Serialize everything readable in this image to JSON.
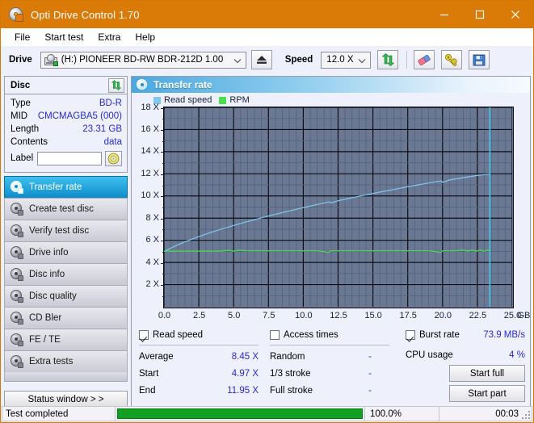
{
  "window": {
    "title": "Opti Drive Control 1.70",
    "icon": "disc-icon",
    "minimize": "minimize-icon",
    "maximize": "maximize-icon",
    "close": "close-icon",
    "accent": "#d97b06"
  },
  "menu": {
    "items": [
      "File",
      "Start test",
      "Extra",
      "Help"
    ]
  },
  "toolbar": {
    "drive_label": "Drive",
    "drive_value": "(H:)  PIONEER BD-RW   BDR-212D 1.00",
    "eject_icon": "eject-icon",
    "speed_label": "Speed",
    "speed_value": "12.0 X",
    "refresh_icon": "refresh-icon",
    "eraser_icon": "eraser-icon",
    "tools_icon": "tools-icon",
    "save_icon": "save-icon"
  },
  "disc": {
    "title": "Disc",
    "refresh_icon": "refresh-icon",
    "rows": [
      {
        "key": "Type",
        "value": "BD-R"
      },
      {
        "key": "MID",
        "value": "CMCMAGBA5 (000)"
      },
      {
        "key": "Length",
        "value": "23.31 GB"
      },
      {
        "key": "Contents",
        "value": "data"
      }
    ],
    "label_key": "Label",
    "label_value": "",
    "label_placeholder": "",
    "label_icon": "cd-icon"
  },
  "nav": {
    "items": [
      {
        "label": "Transfer rate",
        "icon": "disc-icon",
        "active": true
      },
      {
        "label": "Create test disc",
        "icon": "disc-icon",
        "active": false
      },
      {
        "label": "Verify test disc",
        "icon": "disc-icon",
        "active": false
      },
      {
        "label": "Drive info",
        "icon": "disc-icon",
        "active": false
      },
      {
        "label": "Disc info",
        "icon": "disc-icon",
        "active": false
      },
      {
        "label": "Disc quality",
        "icon": "disc-icon",
        "active": false
      },
      {
        "label": "CD Bler",
        "icon": "disc-icon",
        "active": false
      },
      {
        "label": "FE / TE",
        "icon": "disc-icon",
        "active": false
      },
      {
        "label": "Extra tests",
        "icon": "disc-icon",
        "active": false
      }
    ],
    "status_window": "Status window > >"
  },
  "panel": {
    "title": "Transfer rate",
    "icon": "disc-icon"
  },
  "results": {
    "read_speed": {
      "checked": true,
      "label": "Read speed",
      "value": ""
    },
    "access_times": {
      "checked": false,
      "label": "Access times",
      "value": ""
    },
    "burst_rate": {
      "checked": true,
      "label": "Burst rate",
      "value": "73.9 MB/s"
    },
    "col1": [
      {
        "key": "Average",
        "value": "8.45 X"
      },
      {
        "key": "Start",
        "value": "4.97 X"
      },
      {
        "key": "End",
        "value": "11.95 X"
      }
    ],
    "col2": [
      {
        "key": "Random",
        "value": "-"
      },
      {
        "key": "1/3 stroke",
        "value": "-"
      },
      {
        "key": "Full stroke",
        "value": "-"
      }
    ],
    "col3": [
      {
        "key": "CPU usage",
        "value": "4 %"
      }
    ],
    "start_full": "Start full",
    "start_part": "Start part"
  },
  "statusbar": {
    "message": "Test completed",
    "progress_percent": 100.0,
    "progress_text": "100.0%",
    "elapsed": "00:03"
  },
  "chart_data": {
    "type": "line",
    "title": "Transfer rate",
    "xlabel": "GB",
    "ylabel": "X",
    "xlim": [
      0.0,
      25.0
    ],
    "ylim": [
      0,
      18
    ],
    "xticks": [
      0.0,
      2.5,
      5.0,
      7.5,
      10.0,
      12.5,
      15.0,
      17.5,
      20.0,
      22.5,
      25.0
    ],
    "xticklabels": [
      "0.0",
      "2.5",
      "5.0",
      "7.5",
      "10.0",
      "12.5",
      "15.0",
      "17.5",
      "20.0",
      "22.5",
      "25.0"
    ],
    "yticks": [
      2,
      4,
      6,
      8,
      10,
      12,
      14,
      16,
      18
    ],
    "yticklabels": [
      "2 X",
      "4 X",
      "6 X",
      "8 X",
      "10 X",
      "12 X",
      "14 X",
      "16 X",
      "18 X"
    ],
    "grid": true,
    "legend": [
      "Read speed",
      "RPM"
    ],
    "legend_position": "top-left",
    "colors": {
      "read_speed": "#7ec8f0",
      "rpm": "#46e24b",
      "marker": "#44cdee",
      "plot_bg": "#6b7893"
    },
    "marker_x": 23.4,
    "series": [
      {
        "name": "Read speed",
        "color": "#7ec8f0",
        "x": [
          0.0,
          0.5,
          1.0,
          1.5,
          2.0,
          2.5,
          3.0,
          3.5,
          4.0,
          4.5,
          5.0,
          5.5,
          6.0,
          6.5,
          7.0,
          7.5,
          8.0,
          8.5,
          9.0,
          9.5,
          10.0,
          10.5,
          11.0,
          11.5,
          11.9,
          12.0,
          12.5,
          13.0,
          13.5,
          14.0,
          14.5,
          15.0,
          15.5,
          16.0,
          16.5,
          17.0,
          17.5,
          18.0,
          18.5,
          19.0,
          19.5,
          19.95,
          20.0,
          20.5,
          21.0,
          21.5,
          22.0,
          22.5,
          23.0,
          23.4
        ],
        "y": [
          4.97,
          5.3,
          5.6,
          5.86,
          6.1,
          6.33,
          6.55,
          6.76,
          6.96,
          7.15,
          7.34,
          7.52,
          7.69,
          7.86,
          8.03,
          8.19,
          8.35,
          8.5,
          8.65,
          8.8,
          8.95,
          9.09,
          9.23,
          9.37,
          9.47,
          9.37,
          9.57,
          9.7,
          9.84,
          9.97,
          10.1,
          10.22,
          10.35,
          10.47,
          10.59,
          10.71,
          10.83,
          10.95,
          11.06,
          11.17,
          11.28,
          11.36,
          11.22,
          11.44,
          11.55,
          11.65,
          11.75,
          11.85,
          11.93,
          11.95
        ]
      },
      {
        "name": "RPM",
        "color": "#46e24b",
        "x": [
          0.0,
          1.0,
          2.0,
          3.0,
          4.0,
          4.7,
          5.0,
          5.4,
          6.0,
          7.0,
          8.0,
          9.0,
          10.0,
          11.0,
          11.8,
          12.0,
          13.0,
          14.0,
          15.0,
          16.0,
          17.0,
          18.0,
          19.0,
          19.9,
          20.0,
          21.0,
          21.5,
          21.8,
          22.1,
          22.4,
          22.7,
          23.0,
          23.2,
          23.4
        ],
        "y": [
          5.02,
          5.02,
          5.02,
          5.02,
          5.02,
          5.1,
          5.02,
          5.1,
          5.05,
          5.05,
          5.05,
          5.05,
          5.05,
          5.05,
          4.92,
          5.05,
          5.05,
          5.05,
          5.05,
          5.05,
          5.05,
          5.05,
          5.05,
          4.92,
          5.05,
          5.05,
          5.12,
          5.02,
          5.12,
          5.02,
          5.12,
          5.02,
          5.1,
          5.06
        ]
      }
    ]
  }
}
